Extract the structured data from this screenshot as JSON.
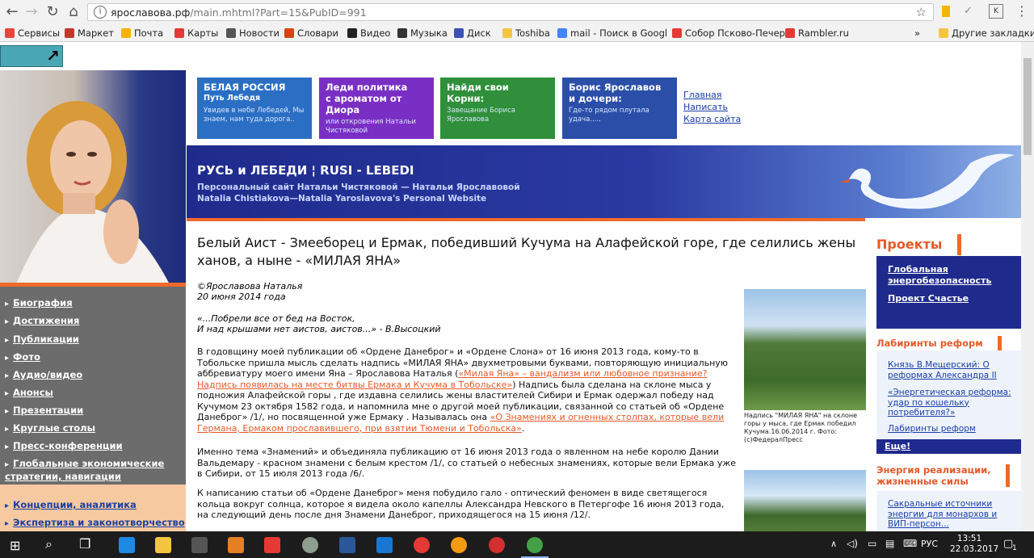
{
  "browser": {
    "url_host": "ярославова.рф",
    "url_path": "/main.mhtml?Part=15&PubID=991",
    "bookmarks": [
      {
        "label": "Сервисы",
        "color": "#e8453c"
      },
      {
        "label": "Маркет",
        "color": "#c0392b"
      },
      {
        "label": "Почта",
        "color": "#f5b400"
      },
      {
        "label": "Карты",
        "color": "#e53935"
      },
      {
        "label": "Новости",
        "color": "#555555"
      },
      {
        "label": "Словари",
        "color": "#d84315"
      },
      {
        "label": "Видео",
        "color": "#222222"
      },
      {
        "label": "Музыка",
        "color": "#333333"
      },
      {
        "label": "Диск",
        "color": "#3f51b5"
      },
      {
        "label": "Toshiba",
        "color": "#f5c542"
      },
      {
        "label": "mail - Поиск в Googl",
        "color": "#4285f4"
      },
      {
        "label": "Собор Псково-Печер",
        "color": "#e53935"
      },
      {
        "label": "Rambler.ru",
        "color": "#e53935"
      }
    ],
    "bookmarks_more": "»",
    "other_bookmarks": "Другие закладки"
  },
  "banners": [
    {
      "title": "БЕЛАЯ РОССИЯ",
      "subtitle": "Путь Лебедя",
      "text": "Увидев в небе Лебедей, Мы знаем, нам туда дорога..",
      "color": "#2b6fc4"
    },
    {
      "title": "Леди политика с ароматом от Диора",
      "subtitle": "",
      "text": "или откровения Натальи Чистяковой",
      "color": "#7a2fc4"
    },
    {
      "title": "Найди свои Корни:",
      "subtitle": "",
      "text": "Завещание Бориса Ярославова",
      "color": "#2f8f3a"
    },
    {
      "title": "Борис Ярославов и дочери:",
      "subtitle": "",
      "text": "Где-то рядом плутала удача.....",
      "color": "#2b4fa8"
    }
  ],
  "top_links": [
    "Главная",
    "Написать",
    "Карта сайта"
  ],
  "header": {
    "title": "РУСЬ и ЛЕБЕДИ ¦ RUSI - LEBEDI",
    "subtitle_ru": "Персональный сайт Натальи Чистяковой — Натальи Ярославовой",
    "subtitle_en": "Natalia Chistiakova—Natalia Yaroslavova's  Personal Website"
  },
  "menu": [
    "Биография",
    "Достижения",
    "Публикации",
    "Фото",
    "Аудио/видео",
    "Анонсы",
    "Презентации",
    "Круглые столы",
    "Пресс-конференции",
    "Глобальные экономические стратегии, навигации"
  ],
  "menu2": [
    "Концепции, аналитика",
    "Экспертиза и законотворчество"
  ],
  "article": {
    "title": "Белый Аист - Змееборец и Ермак, победивший Кучума на Алафейской горе, где селились жены ханов, а ныне - «МИЛАЯ ЯНА»",
    "author": "©Ярославова Наталья",
    "date": "20 июня 2014 года",
    "quote1": "«...Побрели все от бед на Восток,",
    "quote2": "И над крышами нет аистов, аистов...» - В.Высоцкий",
    "p1_text": "В годовщину моей публикации об «Ордене Данеброг» и «Ордене Слона» от 16 июня 2013 года, кому-то в Тобольске пришла мысль сделать надпись «МИЛАЯ ЯНА» двухметровыми буквами, повторяющую инициальную аббревиатуру моего имени Яна – Ярославова Наталья (",
    "p1_link": "«Милая Яна» – вандализм или любовное признание? Надпись появилась на месте битвы Ермака и Кучума в Тобольске»",
    "p1_rest": ") Надпись была сделана на склоне мыса у подножия Алафейской горы , где издавна селились жены властителей Сибири и Ермак одержал победу над Кучумом 23 октября 1582 года, и напомнила мне о другой моей публикации, связанной со статьей об «Ордене Данеброг» /1/, но посвященной уже Ермаку . Называлась она ",
    "p1_link2": "«О Знамениях и огненных столпах, которые вели Германа, Ермаком прославившего, при взятии Тюмени и Тобольска»",
    "p1_end": ".",
    "p2": "Именно тема «Знамений» и объединяла публикацию от 16 июня 2013 года о явленном на небе королю Дании Вальдемару - красном знамени с белым крестом /1/, со статьей о небесных знамениях, которые вели Ермака уже в Сибири, от 15 июля 2013 года /6/.",
    "p3": "К написанию статьи об «Ордене Данеброг» меня побудило гало - оптический феномен в виде светящегося кольца вокруг солнца, которое я видела около капеллы Александра Невского в Петергофе 16 июня 2013 года, на следующий день после дня Знамени Данеброг, приходящегося на 15 июня /12/.",
    "photo_caption": "Надпись \"МИЛАЯ ЯНА\" на склоне горы у мыса, где Ермак победил Кучума.16.06.2014 г. Фото: (с)ФедералПресс"
  },
  "right": {
    "projects_title": "Проекты",
    "projects": [
      "Глобальная энергобезопасность",
      "Проект Счастье"
    ],
    "labyrinths_title": "Лабиринты реформ",
    "labyrinths": [
      "Князь В.Мещерский: О реформах Александра II",
      "«Энергетическая реформа: удар по кошельку потребителя?»",
      "Лабиринты реформ"
    ],
    "more": "Еще!",
    "energy_title": "Энергия реализации, жизненные силы",
    "energy": [
      "Сакральные источники энергии для монархов и ВИП-персон..."
    ]
  },
  "taskbar": {
    "lang": "РУС",
    "time": "13:51",
    "date": "22.03.2017",
    "notif_count": "1"
  }
}
